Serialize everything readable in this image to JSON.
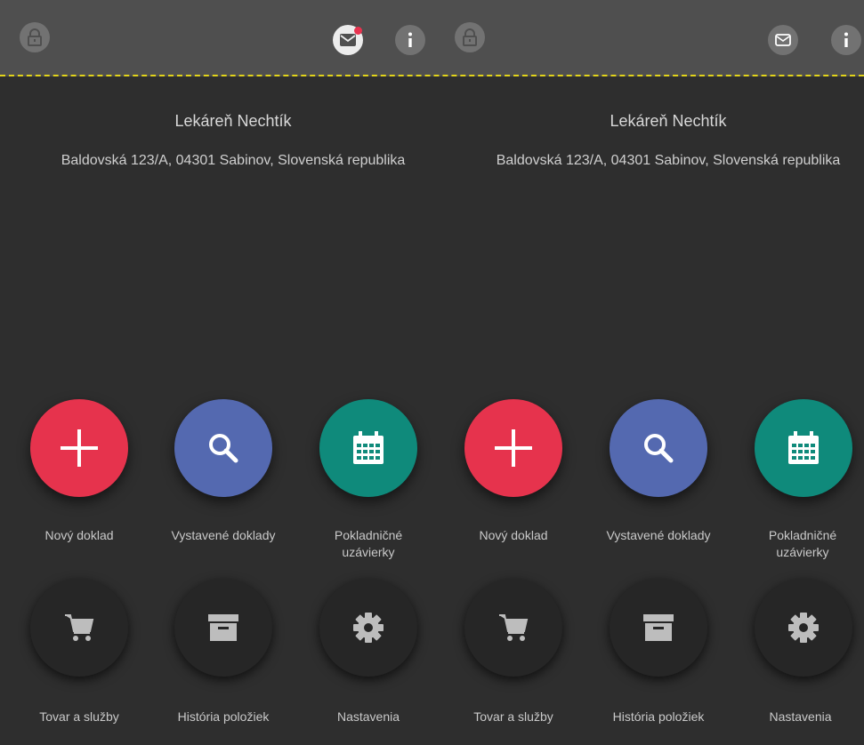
{
  "panes": [
    {
      "store_name": "Lekáreň Nechtík",
      "address": "Baldovská 123/A, 04301 Sabinov, Slovenská republika",
      "mail_has_notification": true,
      "tiles": [
        {
          "label": "Nový doklad",
          "icon": "plus-icon",
          "color": "#e6334d"
        },
        {
          "label": "Vystavené doklady",
          "icon": "search-icon",
          "color": "#5469b0"
        },
        {
          "label": "Pokladničné uzávierky",
          "icon": "calendar-icon",
          "color": "#0f8a7b"
        },
        {
          "label": "Tovar a služby",
          "icon": "cart-icon",
          "color": "#262626"
        },
        {
          "label": "História položiek",
          "icon": "archive-icon",
          "color": "#262626"
        },
        {
          "label": "Nastavenia",
          "icon": "gear-icon",
          "color": "#262626"
        }
      ]
    },
    {
      "store_name": "Lekáreň Nechtík",
      "address": "Baldovská 123/A, 04301 Sabinov, Slovenská republika",
      "mail_has_notification": false,
      "tiles": [
        {
          "label": "Nový doklad",
          "icon": "plus-icon",
          "color": "#e6334d"
        },
        {
          "label": "Vystavené doklady",
          "icon": "search-icon",
          "color": "#5469b0"
        },
        {
          "label": "Pokladničné uzávierky",
          "icon": "calendar-icon",
          "color": "#0f8a7b"
        },
        {
          "label": "Tovar a služby",
          "icon": "cart-icon",
          "color": "#262626"
        },
        {
          "label": "História položiek",
          "icon": "archive-icon",
          "color": "#262626"
        },
        {
          "label": "Nastavenia",
          "icon": "gear-icon",
          "color": "#262626"
        }
      ]
    }
  ],
  "colors": {
    "topbar": "#4f4f4f",
    "background": "#2e2e2e",
    "divider": "#e2d41a",
    "notification": "#e8334f"
  }
}
